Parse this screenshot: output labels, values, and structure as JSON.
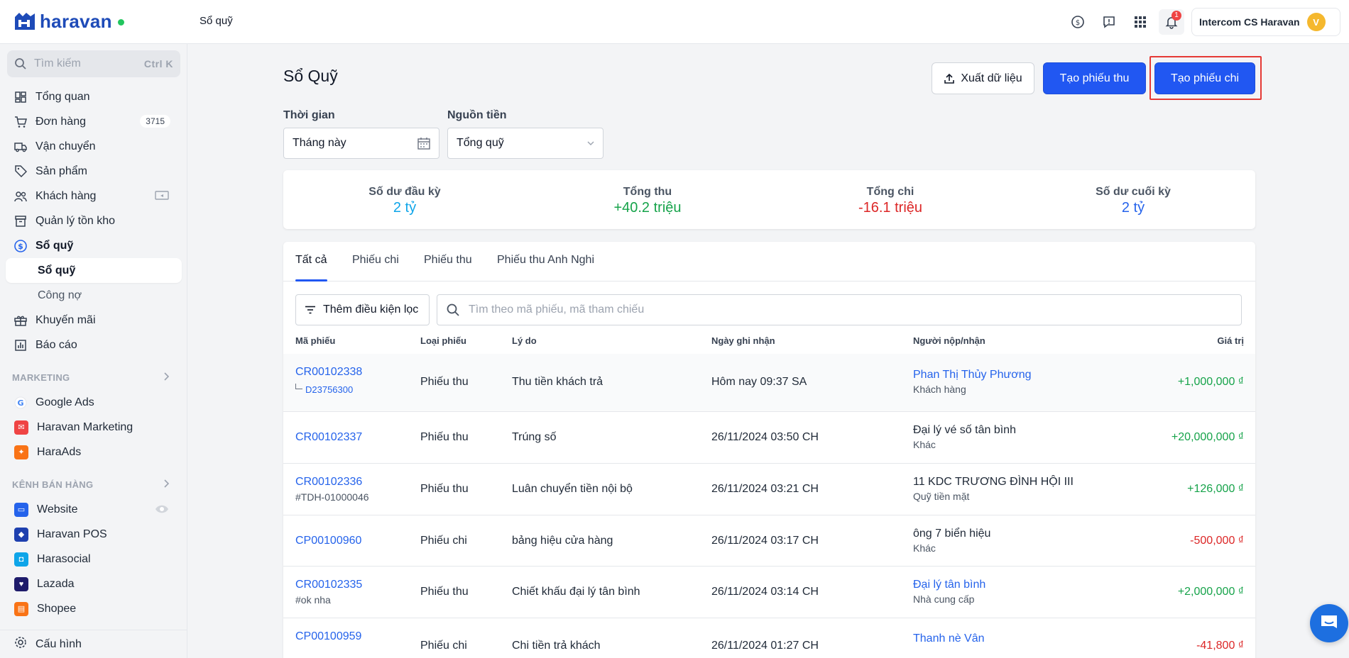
{
  "header": {
    "brand": "haravan",
    "page_title": "Sổ quỹ",
    "notification_count": "1",
    "account_name": "Intercom CS Haravan",
    "avatar_letter": "V"
  },
  "sidebar": {
    "search_placeholder": "Tìm kiếm",
    "search_shortcut": "Ctrl K",
    "items": [
      {
        "label": "Tổng quan"
      },
      {
        "label": "Đơn hàng",
        "count": "3715"
      },
      {
        "label": "Vận chuyển"
      },
      {
        "label": "Sản phẩm"
      },
      {
        "label": "Khách hàng"
      },
      {
        "label": "Quản lý tồn kho"
      },
      {
        "label": "Sổ quỹ"
      }
    ],
    "subitems": [
      {
        "label": "Sổ quỹ"
      },
      {
        "label": "Công nợ"
      }
    ],
    "items2": [
      {
        "label": "Khuyến mãi"
      },
      {
        "label": "Báo cáo"
      }
    ],
    "marketing_title": "MARKETING",
    "marketing": [
      {
        "label": "Google Ads"
      },
      {
        "label": "Haravan Marketing"
      },
      {
        "label": "HaraAds"
      }
    ],
    "channels_title": "KÊNH BÁN HÀNG",
    "channels": [
      {
        "label": "Website"
      },
      {
        "label": "Haravan POS"
      },
      {
        "label": "Harasocial"
      },
      {
        "label": "Lazada"
      },
      {
        "label": "Shopee"
      }
    ],
    "settings": "Cấu hình"
  },
  "main": {
    "title": "Sổ Quỹ",
    "export_label": "Xuất dữ liệu",
    "create_receipt_label": "Tạo phiếu thu",
    "create_payment_label": "Tạo phiếu chi",
    "time_label": "Thời gian",
    "time_value": "Tháng này",
    "source_label": "Nguồn tiền",
    "source_value": "Tổng quỹ",
    "summary": [
      {
        "label": "Số dư đầu kỳ",
        "value": "2 tỷ",
        "color": "#0ea5e9"
      },
      {
        "label": "Tổng thu",
        "value": "+40.2 triệu",
        "color": "#16a34a"
      },
      {
        "label": "Tổng chi",
        "value": "-16.1 triệu",
        "color": "#dc2626"
      },
      {
        "label": "Số dư cuối kỳ",
        "value": "2 tỷ",
        "color": "#2563eb"
      }
    ],
    "tabs": [
      "Tất cả",
      "Phiếu chi",
      "Phiếu thu",
      "Phiếu thu Anh Nghi"
    ],
    "filter_label": "Thêm điều kiện lọc",
    "table_search_placeholder": "Tìm theo mã phiếu, mã tham chiếu",
    "columns": [
      "Mã phiếu",
      "Loại phiếu",
      "Lý do",
      "Ngày ghi nhận",
      "Người nộp/nhận",
      "Giá trị"
    ],
    "rows": [
      {
        "code": "CR00102338",
        "ref": "D23756300",
        "type": "Phiếu thu",
        "reason": "Thu tiền khách trả",
        "date": "Hôm nay 09:37 SA",
        "party": "Phan Thị Thủy Phương",
        "party_type": "Khách hàng",
        "amount": "+1,000,000 ₫"
      },
      {
        "code": "CR00102337",
        "ref": "",
        "type": "Phiếu thu",
        "reason": "Trúng số",
        "date": "26/11/2024 03:50 CH",
        "party": "Đại lý vé số tân bình",
        "party_type": "Khác",
        "amount": "+20,000,000 ₫"
      },
      {
        "code": "CR00102336",
        "ref": "#TDH-01000046",
        "type": "Phiếu thu",
        "reason": "Luân chuyển tiền nội bộ",
        "date": "26/11/2024 03:21 CH",
        "party": "11 KDC TRƯƠNG ĐÌNH HỘI III",
        "party_type": "Quỹ tiền mặt",
        "amount": "+126,000 ₫"
      },
      {
        "code": "CP00100960",
        "ref": "",
        "type": "Phiếu chi",
        "reason": "bảng hiệu cửa hàng",
        "date": "26/11/2024 03:17 CH",
        "party": "ông 7 biển hiệu",
        "party_type": "Khác",
        "amount": "-500,000 ₫"
      },
      {
        "code": "CR00102335",
        "ref": "#ok nha",
        "type": "Phiếu thu",
        "reason": "Chiết khấu đại lý tân bình",
        "date": "26/11/2024 03:14 CH",
        "party": "Đại lý tân bình",
        "party_type": "Nhà cung cấp",
        "amount": "+2,000,000 ₫"
      },
      {
        "code": "CP00100959",
        "ref": "",
        "type": "Phiếu chi",
        "reason": "Chi tiền trả khách",
        "date": "26/11/2024 01:27 CH",
        "party": "Thanh nè Vân",
        "party_type": "",
        "amount": "-41,800 ₫"
      }
    ]
  }
}
